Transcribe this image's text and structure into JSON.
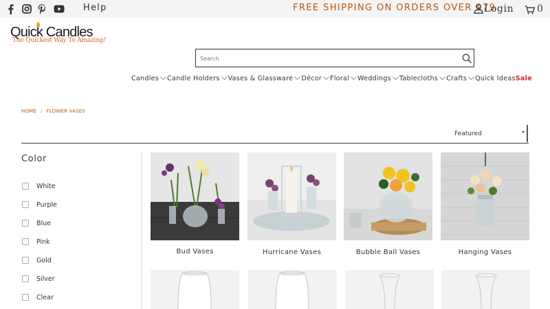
{
  "topbar": {
    "social": [
      {
        "name": "facebook-icon"
      },
      {
        "name": "instagram-icon"
      },
      {
        "name": "pinterest-icon"
      },
      {
        "name": "youtube-icon"
      }
    ],
    "help_label": "Help",
    "shipping_text": "FREE SHIPPING ON ORDERS OVER $79",
    "login_label": "Login",
    "cart_count": "0",
    "accent_color": "#b8560d"
  },
  "logo": {
    "title": "Quick Candles",
    "tagline": "The Quickest Way To Amazing!"
  },
  "search": {
    "placeholder": "Search",
    "value": ""
  },
  "nav": {
    "items": [
      {
        "label": "Candles"
      },
      {
        "label": "Candle Holders"
      },
      {
        "label": "Vases & Glassware"
      },
      {
        "label": "Décor"
      },
      {
        "label": "Floral"
      },
      {
        "label": "Weddings"
      },
      {
        "label": "Tablecloths"
      },
      {
        "label": "Crafts"
      },
      {
        "label": "Quick Ideas"
      }
    ],
    "sale_label": "Sale",
    "sale_color": "#dd2222"
  },
  "breadcrumb": {
    "items": [
      "HOME",
      "FLOWER VASES"
    ],
    "separator": "/"
  },
  "sort": {
    "selected": "Featured"
  },
  "filters": {
    "heading": "Color",
    "options": [
      {
        "label": "White"
      },
      {
        "label": "Purple"
      },
      {
        "label": "Blue"
      },
      {
        "label": "Pink"
      },
      {
        "label": "Gold"
      },
      {
        "label": "Silver"
      },
      {
        "label": "Clear"
      }
    ]
  },
  "products": [
    {
      "name": "Bud Vases"
    },
    {
      "name": "Hurricane Vases"
    },
    {
      "name": "Bubble Ball Vases"
    },
    {
      "name": "Hanging Vases"
    }
  ]
}
